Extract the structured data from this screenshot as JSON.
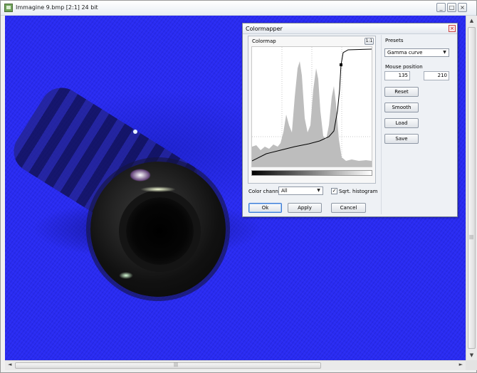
{
  "window": {
    "title": "Immagine 9.bmp [2:1] 24 bit",
    "minimize_glyph": "_",
    "maximize_glyph": "□",
    "close_glyph": "×"
  },
  "icons": {
    "app": "image-icon",
    "close": "close-icon"
  },
  "colors": {
    "image_background": "#2a2cf2",
    "dialog_background": "#eef1f5",
    "accent_button": "#3d7bd4"
  },
  "dialog": {
    "title": "Colormapper",
    "close_glyph": "×",
    "colormap": {
      "label": "Colormap",
      "button_label": "1:1"
    },
    "presets": {
      "label": "Presets",
      "selected": "Gamma curve"
    },
    "mouse_position": {
      "label": "Mouse position",
      "x": "135",
      "y": "210"
    },
    "side_buttons": {
      "reset": "Reset",
      "smooth": "Smooth",
      "load": "Load",
      "save": "Save"
    },
    "channel": {
      "label": "Color channel",
      "selected": "All"
    },
    "sqrt_histogram": {
      "label": "Sqrt. histogram",
      "checked": true,
      "check_glyph": "✓"
    },
    "buttons": {
      "ok": "Ok",
      "apply": "Apply",
      "cancel": "Cancel"
    }
  },
  "scrollbar": {
    "up": "▲",
    "down": "▼",
    "left": "◄",
    "right": "►",
    "grip": "|||"
  }
}
